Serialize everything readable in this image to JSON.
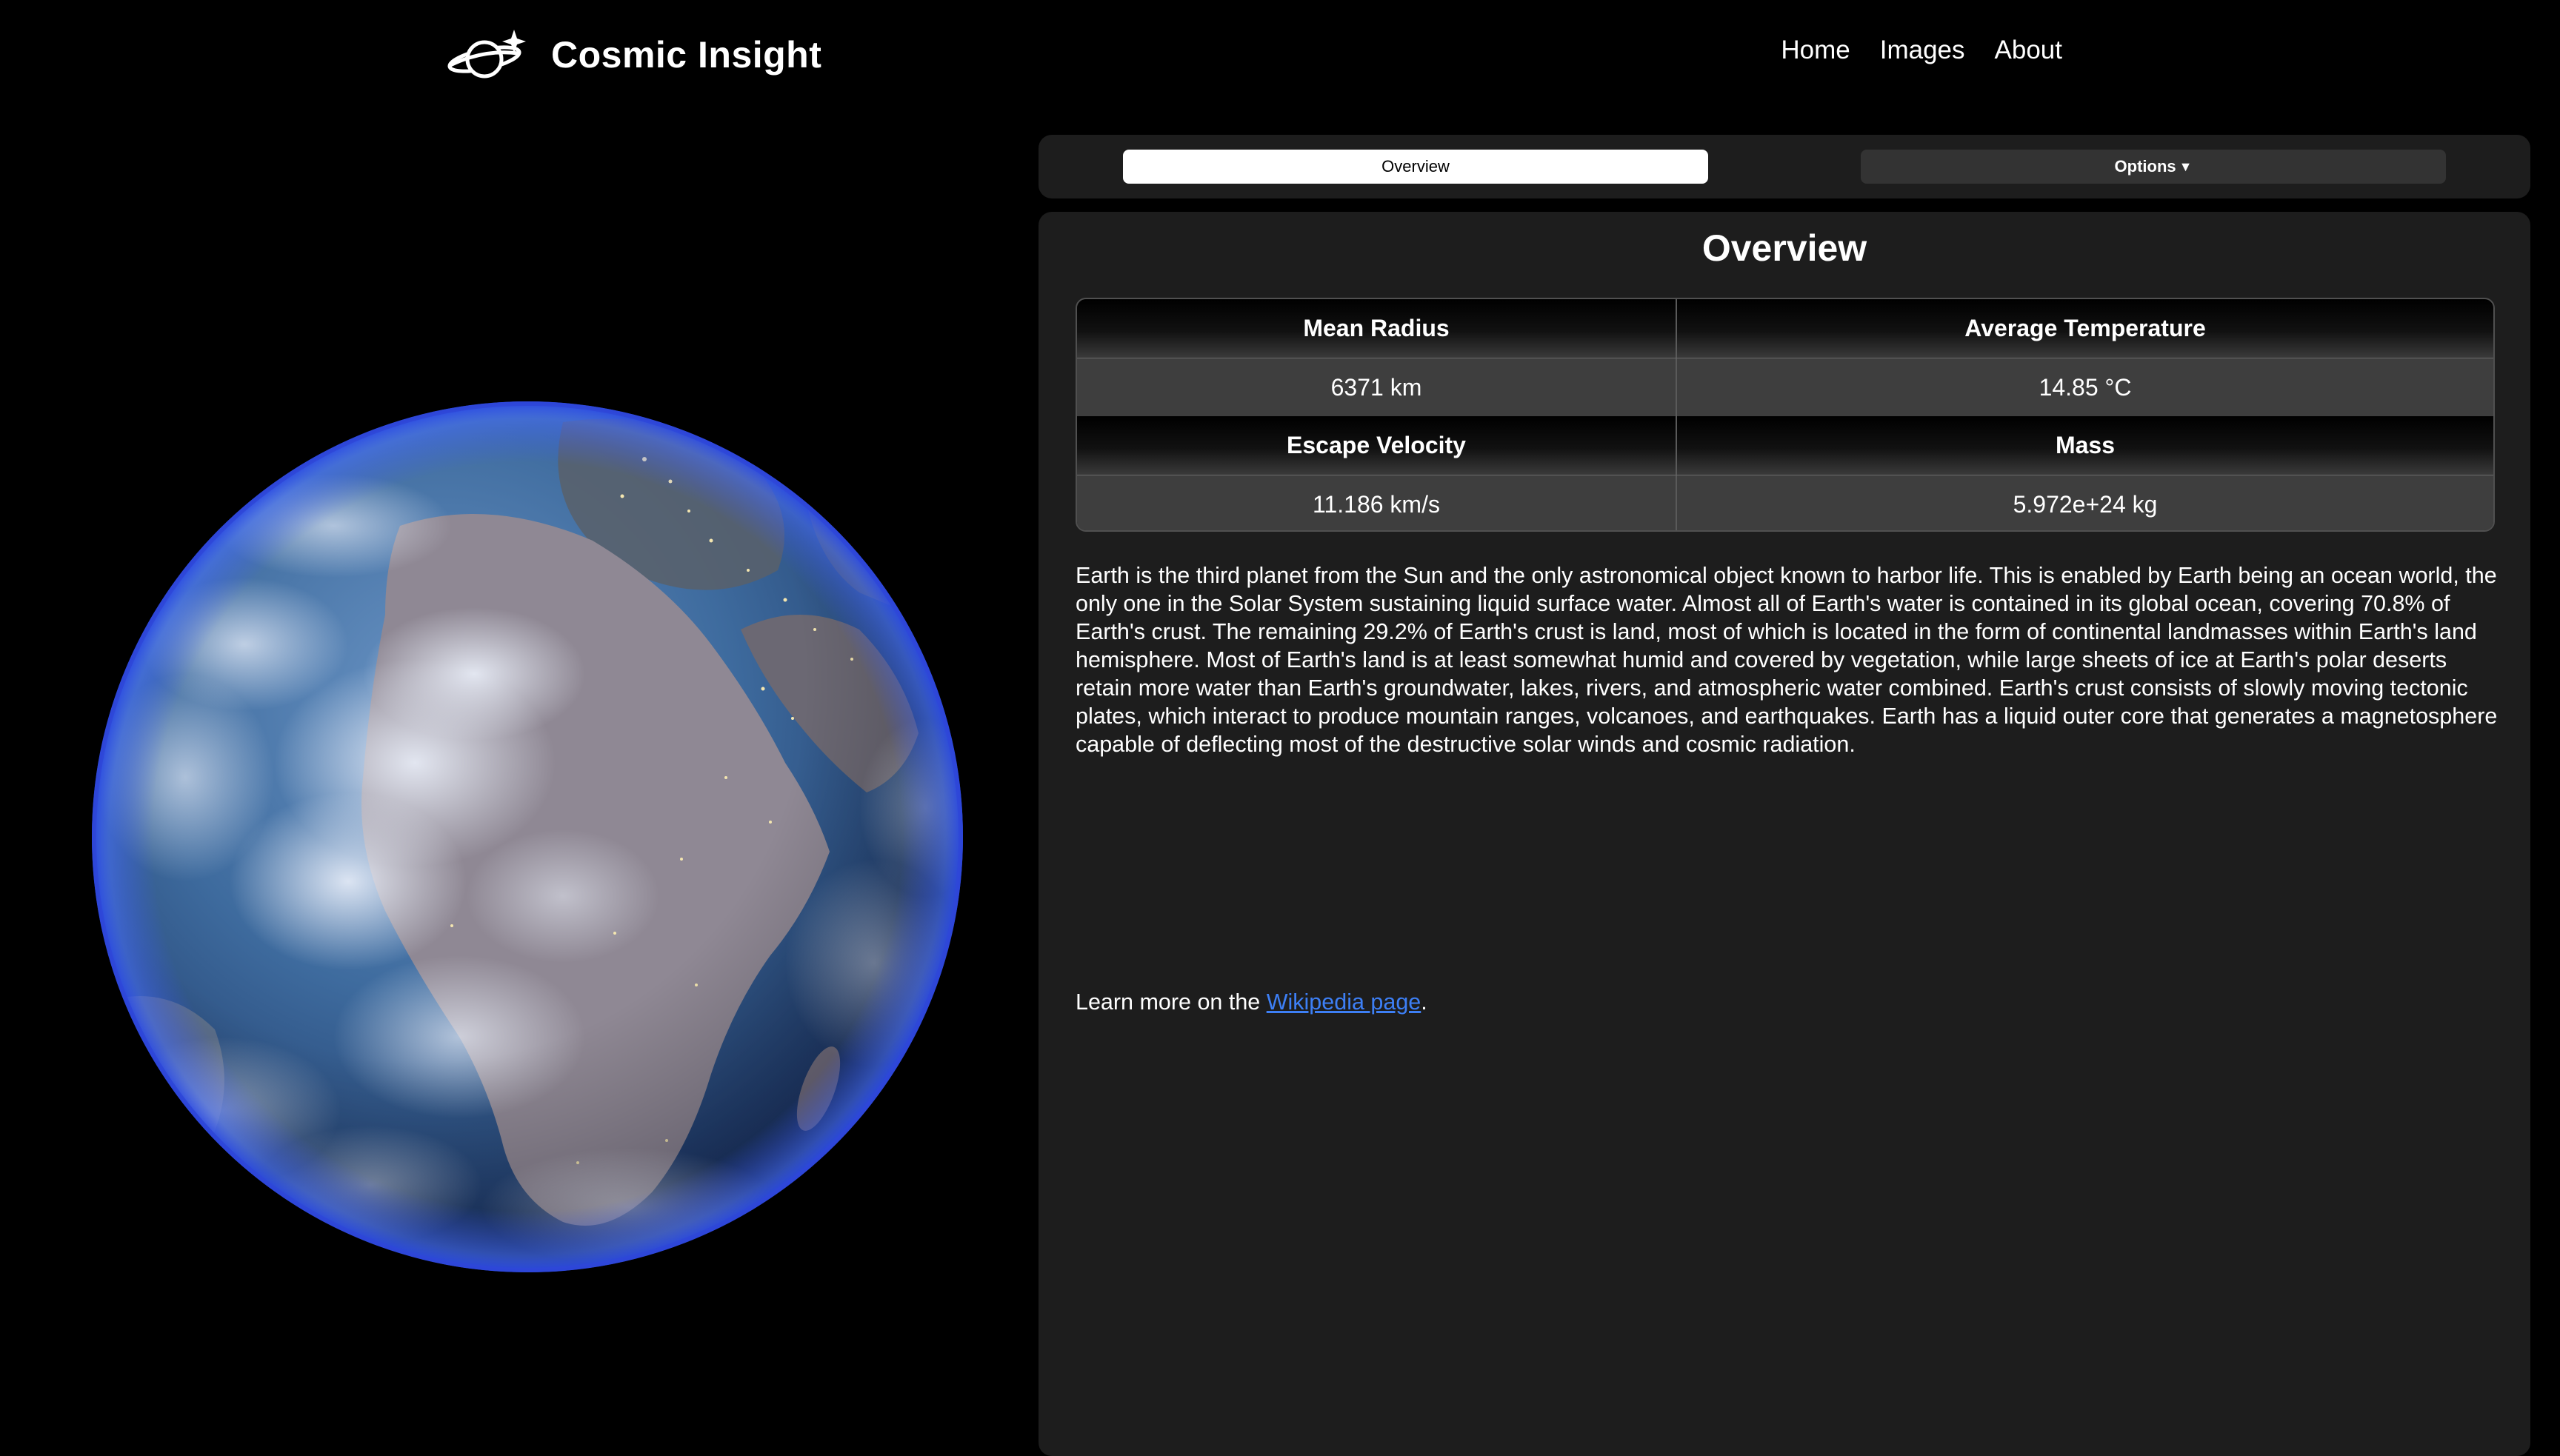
{
  "brand": {
    "name": "Cosmic Insight",
    "logo_icon": "planet-with-star-icon"
  },
  "nav": {
    "items": [
      "Home",
      "Images",
      "About"
    ]
  },
  "planet": {
    "image_icon": "earth-globe-image"
  },
  "tabs": {
    "overview_label": "Overview",
    "options_label": "Options",
    "options_caret": "▼"
  },
  "panel": {
    "title": "Overview",
    "stats": [
      {
        "label": "Mean Radius",
        "value": "6371 km"
      },
      {
        "label": "Average Temperature",
        "value": "14.85 °C"
      },
      {
        "label": "Escape Velocity",
        "value": "11.186 km/s"
      },
      {
        "label": "Mass",
        "value": "5.972e+24 kg"
      }
    ],
    "description": "Earth is the third planet from the Sun and the only astronomical object known to harbor life. This is enabled by Earth being an ocean world, the only one in the Solar System sustaining liquid surface water. Almost all of Earth's water is contained in its global ocean, covering 70.8% of Earth's crust. The remaining 29.2% of Earth's crust is land, most of which is located in the form of continental landmasses within Earth's land hemisphere. Most of Earth's land is at least somewhat humid and covered by vegetation, while large sheets of ice at Earth's polar deserts retain more water than Earth's groundwater, lakes, rivers, and atmospheric water combined. Earth's crust consists of slowly moving tectonic plates, which interact to produce mountain ranges, volcanoes, and earthquakes. Earth has a liquid outer core that generates a magnetosphere capable of deflecting most of the destructive solar winds and cosmic radiation.",
    "learn_more_prefix": "Learn more on the ",
    "learn_more_link": "Wikipedia page",
    "learn_more_suffix": "."
  },
  "colors": {
    "background": "#000000",
    "panel": "#1d1d1d",
    "link": "#3d7ff5",
    "table_value_row": "#3e3e3e",
    "planet_rim": "#3050e0"
  }
}
